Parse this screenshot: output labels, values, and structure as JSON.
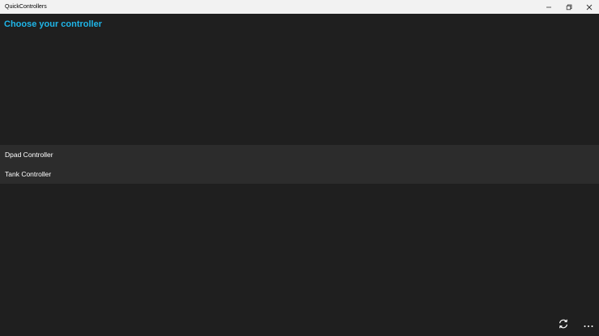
{
  "window": {
    "title": "QuickControllers",
    "controls": {
      "minimize_icon": "minimize-icon",
      "maximize_icon": "restore-icon",
      "close_icon": "close-icon"
    }
  },
  "main": {
    "heading": "Choose your controller",
    "accent_color": "#1fb5e8",
    "controllers": [
      {
        "label": "Dpad Controller"
      },
      {
        "label": "Tank Controller"
      }
    ]
  },
  "appbar": {
    "buttons": [
      {
        "icon": "refresh-icon"
      },
      {
        "icon": "more-icon"
      }
    ]
  }
}
